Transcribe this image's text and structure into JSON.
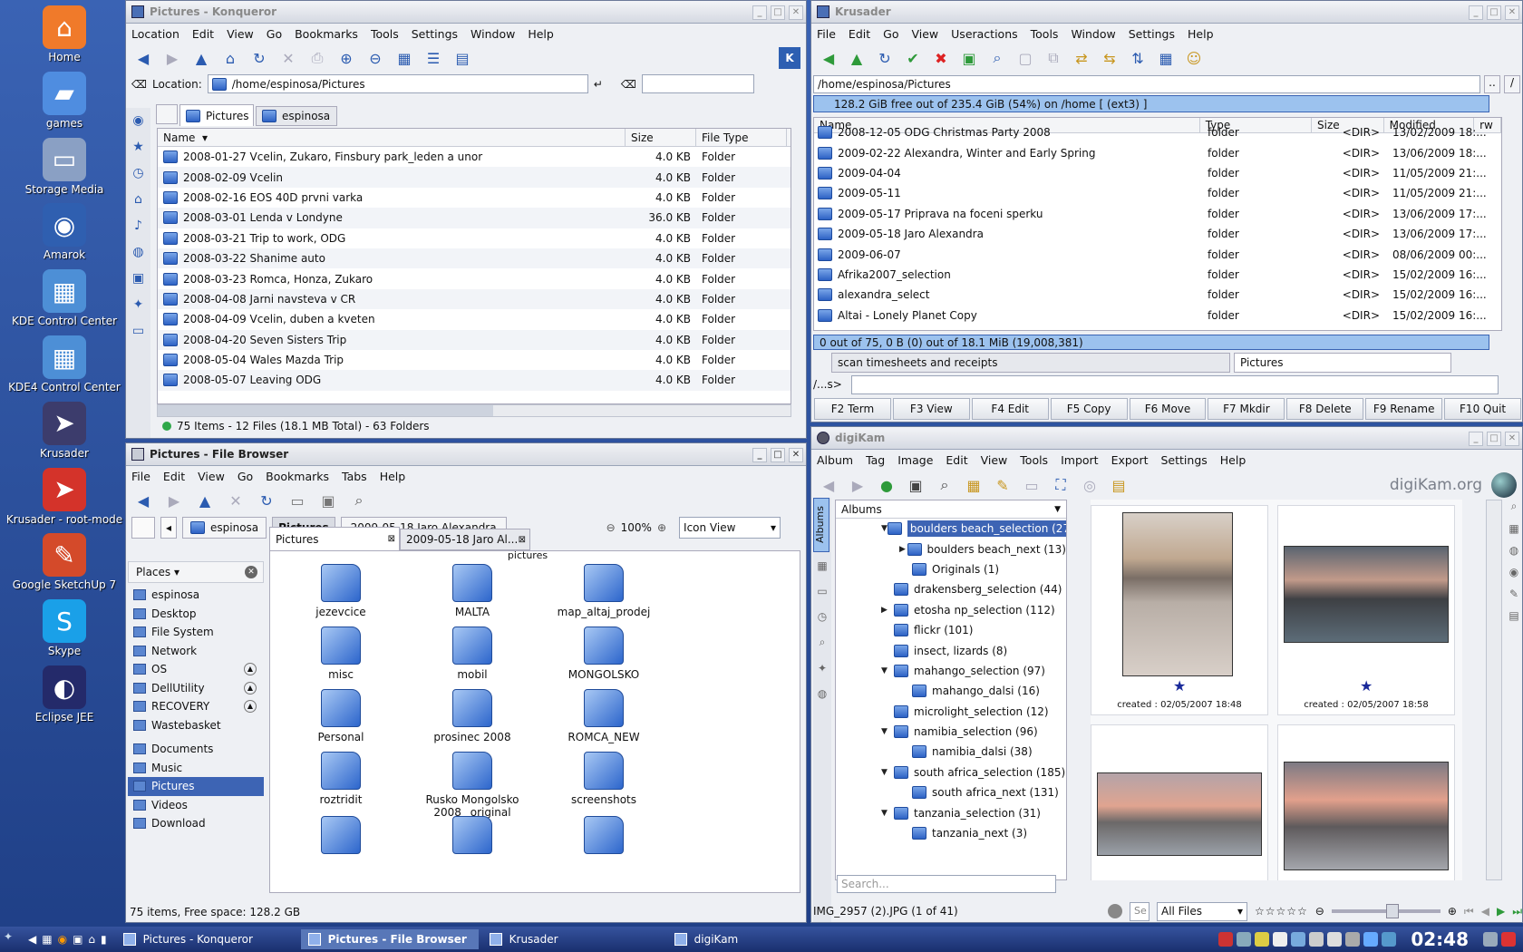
{
  "desktop": {
    "icons": [
      {
        "label": "Home",
        "icon": "home-icon",
        "color": "#f07a2a",
        "glyph": "⌂"
      },
      {
        "label": "games",
        "icon": "games-folder-icon",
        "color": "#4f8de0",
        "glyph": "▰"
      },
      {
        "label": "Storage Media",
        "icon": "storage-media-icon",
        "color": "#8aa0c4",
        "glyph": "▭"
      },
      {
        "label": "Amarok",
        "icon": "amarok-icon",
        "color": "#2f5fb0",
        "glyph": "◉"
      },
      {
        "label": "KDE Control Center",
        "icon": "kde-control-center-icon",
        "color": "#4d8fd6",
        "glyph": "▦"
      },
      {
        "label": "KDE4 Control Center",
        "icon": "kde4-control-center-icon",
        "color": "#4d8fd6",
        "glyph": "▦"
      },
      {
        "label": "Krusader",
        "icon": "krusader-icon",
        "color": "#3c3c6c",
        "glyph": "➤"
      },
      {
        "label": "Krusader - root-mode",
        "icon": "krusader-root-icon",
        "color": "#d4332a",
        "glyph": "➤"
      },
      {
        "label": "Google SketchUp 7",
        "icon": "sketchup-icon",
        "color": "#d44a2a",
        "glyph": "✎"
      },
      {
        "label": "Skype",
        "icon": "skype-icon",
        "color": "#1aa0e8",
        "glyph": "S"
      },
      {
        "label": "Eclipse JEE",
        "icon": "eclipse-icon",
        "color": "#242a6a",
        "glyph": "◐"
      }
    ]
  },
  "konqueror": {
    "title": "Pictures - Konqueror",
    "menu": [
      "Location",
      "Edit",
      "View",
      "Go",
      "Bookmarks",
      "Tools",
      "Settings",
      "Window",
      "Help"
    ],
    "location_label": "Location:",
    "location": "/home/espinosa/Pictures",
    "tabs": [
      "Pictures",
      "espinosa"
    ],
    "columns": [
      "Name",
      "Size",
      "File Type"
    ],
    "rows": [
      {
        "name": "2008-01-27 Vcelin, Zukaro, Finsbury park_leden a unor",
        "size": "4.0 KB",
        "type": "Folder"
      },
      {
        "name": "2008-02-09 Vcelin",
        "size": "4.0 KB",
        "type": "Folder"
      },
      {
        "name": "2008-02-16 EOS 40D prvni varka",
        "size": "4.0 KB",
        "type": "Folder"
      },
      {
        "name": "2008-03-01 Lenda v Londyne",
        "size": "36.0 KB",
        "type": "Folder"
      },
      {
        "name": "2008-03-21 Trip to work, ODG",
        "size": "4.0 KB",
        "type": "Folder"
      },
      {
        "name": "2008-03-22 Shanime auto",
        "size": "4.0 KB",
        "type": "Folder"
      },
      {
        "name": "2008-03-23 Romca, Honza, Zukaro",
        "size": "4.0 KB",
        "type": "Folder"
      },
      {
        "name": "2008-04-08 Jarni navsteva v CR",
        "size": "4.0 KB",
        "type": "Folder"
      },
      {
        "name": "2008-04-09 Vcelin, duben a kveten",
        "size": "4.0 KB",
        "type": "Folder"
      },
      {
        "name": "2008-04-20 Seven Sisters Trip",
        "size": "4.0 KB",
        "type": "Folder"
      },
      {
        "name": "2008-05-04 Wales Mazda Trip",
        "size": "4.0 KB",
        "type": "Folder"
      },
      {
        "name": "2008-05-07 Leaving ODG",
        "size": "4.0 KB",
        "type": "Folder"
      }
    ],
    "status": "75 Items - 12 Files (18.1 MB Total) - 63 Folders"
  },
  "krusader": {
    "title": "Krusader",
    "menu": [
      "File",
      "Edit",
      "Go",
      "View",
      "Useractions",
      "Tools",
      "Window",
      "Settings",
      "Help"
    ],
    "path": "/home/espinosa/Pictures",
    "freespace": "128.2 GiB free out of 235.4 GiB (54%) on /home [ (ext3) ]",
    "columns": [
      "Name",
      "Type",
      "Size",
      "Modified",
      "rw"
    ],
    "rows": [
      {
        "name": "2008-12-05 ODG Christmas Party 2008",
        "type": "folder",
        "size": "<DIR>",
        "mod": "13/02/2009 18:..."
      },
      {
        "name": "2009-02-22 Alexandra, Winter and Early Spring",
        "type": "folder",
        "size": "<DIR>",
        "mod": "13/06/2009 18:..."
      },
      {
        "name": "2009-04-04",
        "type": "folder",
        "size": "<DIR>",
        "mod": "11/05/2009 21:..."
      },
      {
        "name": "2009-05-11",
        "type": "folder",
        "size": "<DIR>",
        "mod": "11/05/2009 21:..."
      },
      {
        "name": "2009-05-17 Priprava na foceni sperku",
        "type": "folder",
        "size": "<DIR>",
        "mod": "13/06/2009 17:..."
      },
      {
        "name": "2009-05-18 Jaro Alexandra",
        "type": "folder",
        "size": "<DIR>",
        "mod": "13/06/2009 17:..."
      },
      {
        "name": "2009-06-07",
        "type": "folder",
        "size": "<DIR>",
        "mod": "08/06/2009 00:..."
      },
      {
        "name": "Afrika2007_selection",
        "type": "folder",
        "size": "<DIR>",
        "mod": "15/02/2009 16:..."
      },
      {
        "name": "alexandra_select",
        "type": "folder",
        "size": "<DIR>",
        "mod": "15/02/2009 16:..."
      },
      {
        "name": "Altai - Lonely Planet Copy",
        "type": "folder",
        "size": "<DIR>",
        "mod": "15/02/2009 16:..."
      }
    ],
    "status": "0 out of 75, 0 B (0) out of 18.1 MiB (19,008,381)",
    "tabs": [
      "scan timesheets and receipts",
      "Pictures"
    ],
    "cmd_prompt": "/...s>",
    "fkeys": [
      "F2 Term",
      "F3 View",
      "F4 Edit",
      "F5 Copy",
      "F6 Move",
      "F7 Mkdir",
      "F8 Delete",
      "F9 Rename",
      "F10 Quit"
    ]
  },
  "filebrowser": {
    "title": "Pictures - File Browser",
    "menu": [
      "File",
      "Edit",
      "View",
      "Go",
      "Bookmarks",
      "Tabs",
      "Help"
    ],
    "crumbs": [
      "espinosa",
      "Pictures",
      "2009-05-18 Jaro Alexandra"
    ],
    "zoom": "100%",
    "view_mode": "Icon View",
    "places_label": "Places",
    "places": [
      "espinosa",
      "Desktop",
      "File System",
      "Network",
      "OS",
      "DellUtility",
      "RECOVERY",
      "Wastebasket"
    ],
    "bookmarks": [
      "Documents",
      "Music",
      "Pictures",
      "Videos",
      "Download"
    ],
    "tabs": [
      "Pictures",
      "2009-05-18 Jaro Al..."
    ],
    "partial_top": "pictures",
    "icons": [
      "jezevcice",
      "MALTA",
      "map_altaj_prodej",
      "misc",
      "mobil",
      "MONGOLSKO",
      "Personal",
      "prosinec 2008",
      "ROMCA_NEW",
      "roztridit",
      "Rusko Mongolsko 2008_ original",
      "screenshots"
    ],
    "status": "75 items, Free space: 128.2 GB"
  },
  "digikam": {
    "title": "digiKam",
    "menu": [
      "Album",
      "Tag",
      "Image",
      "Edit",
      "View",
      "Tools",
      "Import",
      "Export",
      "Settings",
      "Help"
    ],
    "brand": "digiKam.org",
    "side_tab": "Albums",
    "albums_header": "Albums",
    "albums": [
      {
        "label": "boulders beach_selection (27)",
        "indent": 0,
        "arrow": "▼",
        "selected": true
      },
      {
        "label": "boulders beach_next (13)",
        "indent": 1,
        "arrow": "▶"
      },
      {
        "label": "Originals (1)",
        "indent": 1,
        "arrow": ""
      },
      {
        "label": "drakensberg_selection (44)",
        "indent": 0,
        "arrow": ""
      },
      {
        "label": "etosha np_selection (112)",
        "indent": 0,
        "arrow": "▶"
      },
      {
        "label": "flickr (101)",
        "indent": 0,
        "arrow": ""
      },
      {
        "label": "insect, lizards (8)",
        "indent": 0,
        "arrow": ""
      },
      {
        "label": "mahango_selection (97)",
        "indent": 0,
        "arrow": "▼"
      },
      {
        "label": "mahango_dalsi (16)",
        "indent": 1,
        "arrow": ""
      },
      {
        "label": "microlight_selection (12)",
        "indent": 0,
        "arrow": ""
      },
      {
        "label": "namibia_selection (96)",
        "indent": 0,
        "arrow": "▼"
      },
      {
        "label": "namibia_dalsi (38)",
        "indent": 1,
        "arrow": ""
      },
      {
        "label": "south africa_selection (185)",
        "indent": 0,
        "arrow": "▼"
      },
      {
        "label": "south africa_next (131)",
        "indent": 1,
        "arrow": ""
      },
      {
        "label": "tanzania_selection (31)",
        "indent": 0,
        "arrow": "▼"
      },
      {
        "label": "tanzania_next (3)",
        "indent": 1,
        "arrow": ""
      }
    ],
    "search_placeholder": "Search...",
    "captions": [
      "created : 02/05/2007 18:48",
      "created : 02/05/2007 18:58"
    ],
    "status": "IMG_2957 (2).JPG (1 of 41)",
    "filter": "All Files",
    "status_search_placeholder": "Se"
  },
  "taskbar": {
    "tasks": [
      "Pictures - Konqueror",
      "Pictures - File Browser",
      "Krusader",
      "digiKam"
    ],
    "clock": "02:48"
  }
}
